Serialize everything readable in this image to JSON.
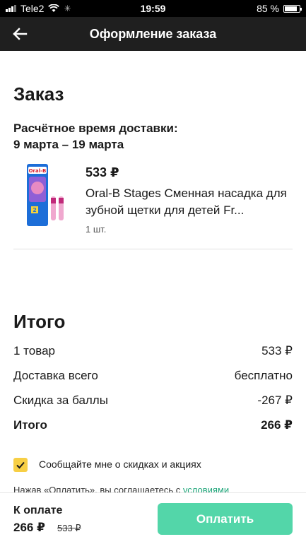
{
  "status_bar": {
    "carrier": "Tele2",
    "time": "19:59",
    "battery_text": "85 %",
    "battery_level": 0.85
  },
  "header": {
    "title": "Оформление заказа",
    "back_icon": "arrow-left-icon"
  },
  "order": {
    "title": "Заказ",
    "delivery_label": "Расчётное время доставки:",
    "delivery_dates": "9 марта – 19 марта",
    "product": {
      "price": "533 ₽",
      "name": "Oral-B Stages Сменная насадка для зубной щетки для детей Fr...",
      "quantity": "1 шт.",
      "image_icon": "toothbrush-heads-package-image"
    }
  },
  "summary": {
    "title": "Итого",
    "rows": [
      {
        "label": "1 товар",
        "value": "533 ₽"
      },
      {
        "label": "Доставка всего",
        "value": "бесплатно"
      },
      {
        "label": "Скидка за баллы",
        "value": "-267 ₽"
      },
      {
        "label": "Итого",
        "value": "266 ₽"
      }
    ]
  },
  "newsletter": {
    "label": "Сообщайте мне о скидках и акциях",
    "checked": true
  },
  "terms": {
    "text": "Нажав «Оплатить», вы соглашаетесь с ",
    "link": "условиями"
  },
  "payment": {
    "label": "К оплате",
    "total": "266 ₽",
    "old_total": "533 ₽",
    "button_label": "Оплатить"
  },
  "colors": {
    "accent_green": "#53d6a9",
    "checkbox_yellow": "#f7cf45",
    "header_bg": "#1f1f1f"
  }
}
